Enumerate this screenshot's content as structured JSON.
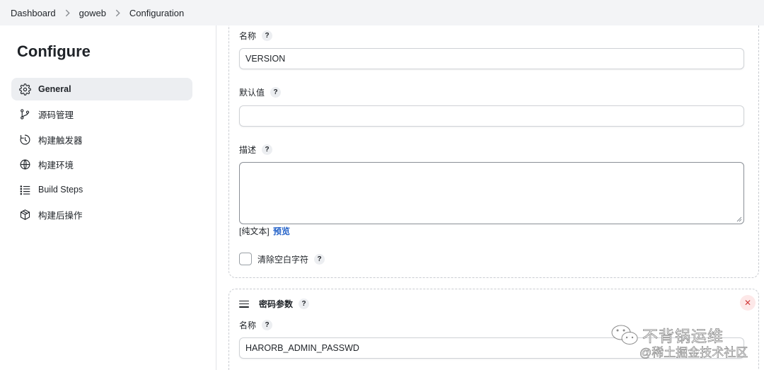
{
  "breadcrumb": {
    "items": [
      "Dashboard",
      "goweb",
      "Configuration"
    ]
  },
  "sidebar": {
    "title": "Configure",
    "items": [
      {
        "label": "General",
        "icon": "gear-icon",
        "active": true
      },
      {
        "label": "源码管理",
        "icon": "branch-icon"
      },
      {
        "label": "构建触发器",
        "icon": "clock-icon"
      },
      {
        "label": "构建环境",
        "icon": "globe-icon"
      },
      {
        "label": "Build Steps",
        "icon": "list-icon"
      },
      {
        "label": "构建后操作",
        "icon": "package-icon"
      }
    ]
  },
  "string_param": {
    "name_label": "名称",
    "name_value": "VERSION",
    "default_label": "默认值",
    "default_value": "",
    "description_label": "描述",
    "description_value": "",
    "format_text": "[纯文本]",
    "preview_label": "预览",
    "trim_label": "清除空白字符",
    "help_glyph": "?"
  },
  "password_param": {
    "title": "密码参数",
    "name_label": "名称",
    "name_value": "HARORB_ADMIN_PASSWD",
    "delete_glyph": "✕"
  },
  "watermark": {
    "line1": "不背锅运维",
    "line2": "@稀土掘金技术社区"
  },
  "colors": {
    "accent_link": "#2563c9",
    "active_nav_bg": "#eceef1",
    "delete_bg": "#fde8e8",
    "delete_fg": "#d23b3b"
  }
}
